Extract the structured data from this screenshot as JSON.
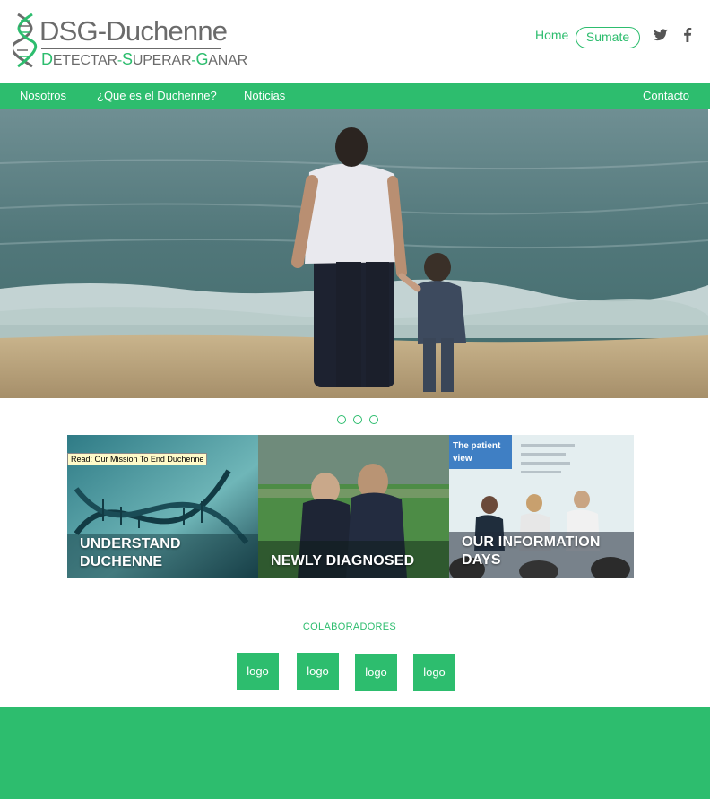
{
  "brand": {
    "name": "DSG-Duchenne",
    "tagline_letters": [
      {
        "cap": "D",
        "rest": "ETECTAR"
      },
      {
        "cap": "S",
        "rest": "UPERAR"
      },
      {
        "cap": "G",
        "rest": "ANAR"
      }
    ],
    "tagline_separator": "-",
    "accent_color": "#2dbd6e",
    "text_color": "#6b6b6b"
  },
  "top_nav": {
    "home": "Home",
    "sumate": "Sumate",
    "social": [
      "twitter-icon",
      "facebook-icon"
    ]
  },
  "main_nav": {
    "items": [
      "Nosotros",
      "¿Que es el Duchenne?",
      "Noticias"
    ],
    "contact": "Contacto"
  },
  "hero": {
    "alt": "Father and child walking along the beach"
  },
  "carousel": {
    "dots": 3
  },
  "cards": [
    {
      "title_line1": "UNDERSTAND",
      "title_line2": "DUCHENNE",
      "tag": "Read: Our Mission To End Duchenne"
    },
    {
      "title_line1": "NEWLY DIAGNOSED",
      "title_line2": ""
    },
    {
      "title_line1": "OUR INFORMATION",
      "title_line2": "DAYS",
      "panel_text": "The patient view"
    }
  ],
  "colaboradores": {
    "title": "COLABORADORES",
    "logos": [
      "logo",
      "logo",
      "logo",
      "logo"
    ]
  }
}
